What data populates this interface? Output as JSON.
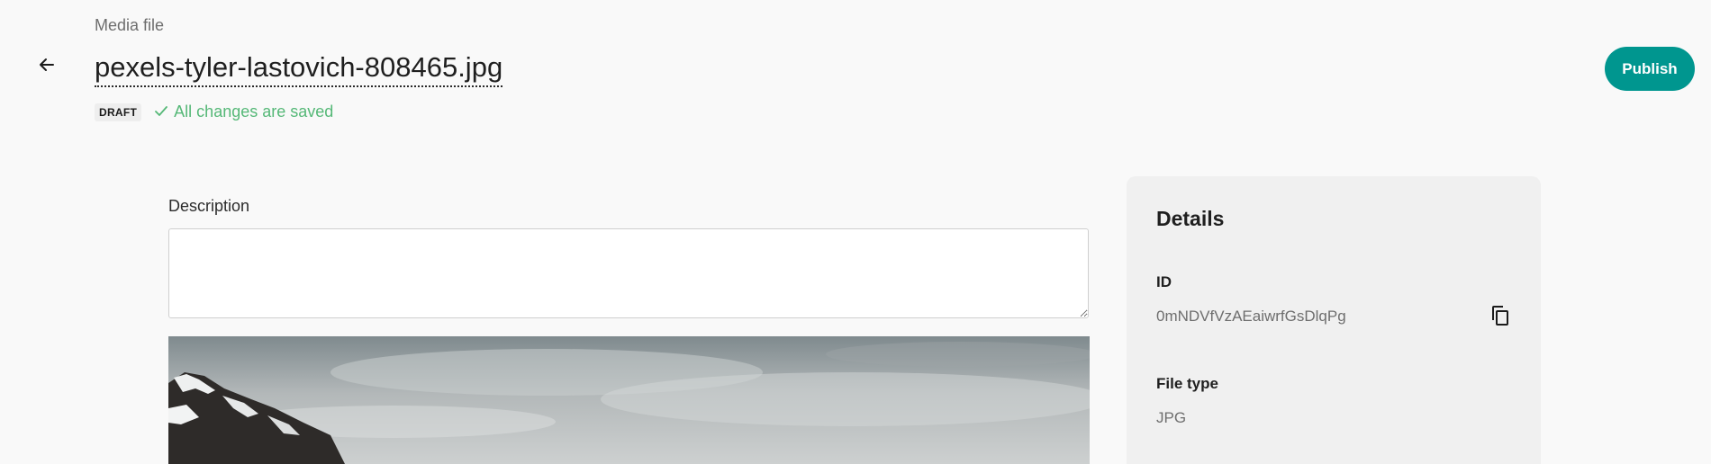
{
  "header": {
    "breadcrumb": "Media file",
    "title": "pexels-tyler-lastovich-808465.jpg",
    "status_badge": "DRAFT",
    "save_status": "All changes are saved",
    "publish_label": "Publish"
  },
  "form": {
    "description_label": "Description",
    "description_value": ""
  },
  "details": {
    "title": "Details",
    "id_label": "ID",
    "id_value": "0mNDVfVzAEaiwrfGsDlqPg",
    "file_type_label": "File type",
    "file_type_value": "JPG"
  },
  "colors": {
    "accent": "#00968f",
    "success": "#55b877"
  },
  "icons": {
    "back": "arrow-left-icon",
    "saved": "check-icon",
    "copy": "copy-icon"
  }
}
